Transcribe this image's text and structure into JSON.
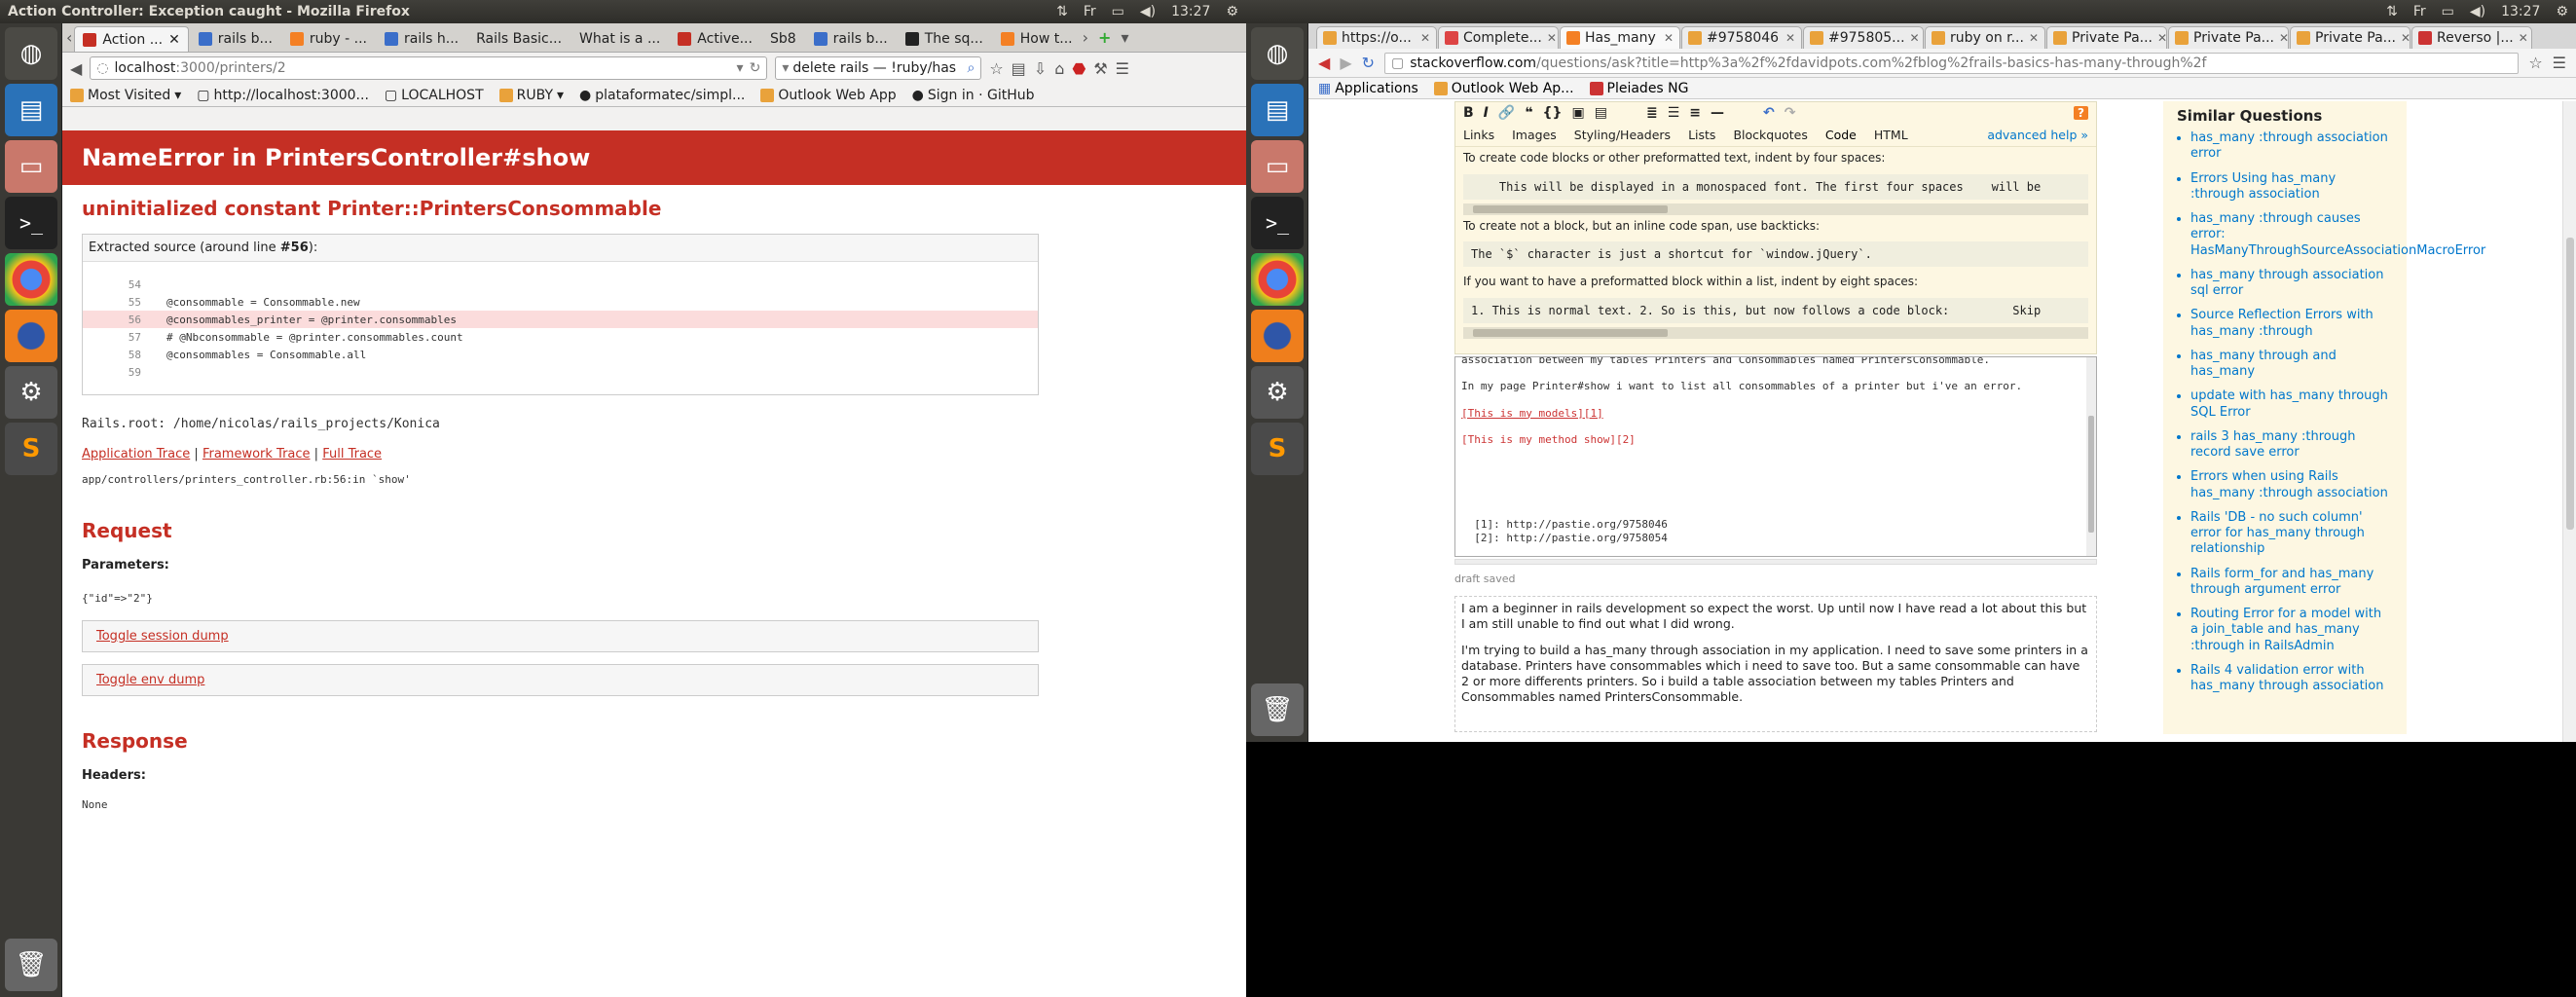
{
  "left": {
    "panel_title": "Action Controller: Exception caught - Mozilla Firefox",
    "clock": "13:27",
    "tabs": [
      "Action ...",
      "rails b...",
      "ruby - ...",
      "rails h...",
      "Rails Basic...",
      "What is a ...",
      "Active...",
      "Sb8",
      "rails b...",
      "The sq...",
      "How t..."
    ],
    "url_host": "localhost",
    "url_path": ":3000/printers/2",
    "search_text": "delete rails — !ruby/has",
    "bookmarks": [
      "Most Visited",
      "http://localhost:3000...",
      "LOCALHOST",
      "RUBY",
      "plataformatec/simpl...",
      "Outlook Web App",
      "Sign in · GitHub"
    ],
    "error_header": "NameError in PrintersController#show",
    "error_message": "uninitialized constant Printer::PrintersConsommable",
    "source_title_prefix": "Extracted source (around line ",
    "source_line_ref": "#56",
    "source_title_suffix": "):",
    "source_lines": [
      {
        "n": "54",
        "code": ""
      },
      {
        "n": "55",
        "code": "@consommable = Consommable.new"
      },
      {
        "n": "56",
        "code": "@consommables_printer = @printer.consommables"
      },
      {
        "n": "57",
        "code": "# @Nbconsommable = @printer.consommables.count"
      },
      {
        "n": "58",
        "code": "@consommables = Consommable.all"
      },
      {
        "n": "59",
        "code": ""
      }
    ],
    "rails_root": "Rails.root: /home/nicolas/rails_projects/Konica",
    "trace_links": [
      "Application Trace",
      "Framework Trace",
      "Full Trace"
    ],
    "trace_sep": "|",
    "trace_line": "app/controllers/printers_controller.rb:56:in `show'",
    "request_heading": "Request",
    "parameters_label": "Parameters:",
    "parameters_value": "{\"id\"=>\"2\"}",
    "toggle_session": "Toggle session dump",
    "toggle_env": "Toggle env dump",
    "response_heading": "Response",
    "headers_label": "Headers:",
    "headers_value": "None"
  },
  "right": {
    "clock": "13:27",
    "tabs": [
      "https://o...",
      "Complete...",
      "Has_many",
      "#9758046",
      "#975805...",
      "ruby on r...",
      "Private Pa...",
      "Private Pa...",
      "Private Pa...",
      "Reverso |..."
    ],
    "url_host": "stackoverflow.com",
    "url_path": "/questions/ask?title=http%3a%2f%2fdavidpots.com%2fblog%2frails-basics-has-many-through%2f",
    "bookmarks": [
      "Applications",
      "Outlook Web Ap...",
      "Pleiades NG"
    ],
    "help_tabs": [
      "Links",
      "Images",
      "Styling/Headers",
      "Lists",
      "Blockquotes",
      "Code",
      "HTML"
    ],
    "advanced_help": "advanced help »",
    "help_p1": "To create code blocks or other preformatted text, indent by four spaces:",
    "help_pre1": "    This will be displayed in a monospaced font. The first four spaces    will be",
    "help_p2": "To create not a block, but an inline code span, use backticks:",
    "help_pre2": "The `$` character is just a shortcut for `window.jQuery`.",
    "help_p3": "If you want to have a preformatted block within a list, indent by eight spaces:",
    "help_pre3": "1. This is normal text. 2. So is this, but now follows a code block:         Skip",
    "editor_lines": [
      "association between my tables Printers and Consommables named PrintersConsommable.",
      "In my page Printer#show i want to list all consommables of a printer but i've an error.",
      "[This is my models][1]",
      "[This is my method show][2]"
    ],
    "editor_refs": [
      "  [1]: http://pastie.org/9758046",
      "  [2]: http://pastie.org/9758054"
    ],
    "draft_saved": "draft saved",
    "preview_p1": "I am a beginner in rails development so expect the worst. Up until now I have read a lot about this but I am still unable to find out what I did wrong.",
    "preview_p2": "I'm trying to build a has_many through association in my application. I need to save some printers in a database. Printers have consommables which i need to save too. But a same consommable can have 2 or more differents printers. So i build a table association between my tables Printers and Consommables named PrintersConsommable.",
    "similar_heading": "Similar Questions",
    "similar": [
      "has_many :through association error",
      "Errors Using has_many :through association",
      "has_many :through causes error: HasManyThroughSourceAssociationMacroError",
      "has_many through association sql error",
      "Source Reflection Errors with has_many :through",
      "has_many through and has_many",
      "update with has_many through SQL Error",
      "rails 3 has_many :through record save error",
      "Errors when using Rails has_many :through association",
      "Rails 'DB - no such column' error for has_many through relationship",
      "Rails form_for and has_many through argument error",
      "Routing Error for a model with a join_table and has_many :through in RailsAdmin",
      "Rails 4 validation error with has_many through association"
    ]
  }
}
